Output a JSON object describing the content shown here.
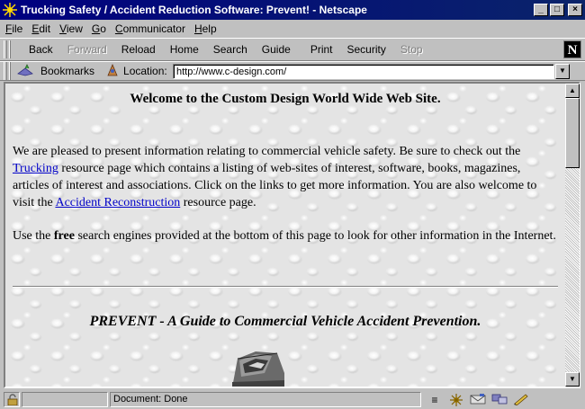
{
  "window": {
    "title": "Trucking Safety / Accident Reduction Software: Prevent! - Netscape",
    "buttons": {
      "minimize": "_",
      "maximize": "□",
      "close": "×"
    }
  },
  "menu": [
    "File",
    "Edit",
    "View",
    "Go",
    "Communicator",
    "Help"
  ],
  "menu_accel": [
    "F",
    "E",
    "V",
    "G",
    "C",
    "H"
  ],
  "toolbar": {
    "back": "Back",
    "forward": "Forward",
    "reload": "Reload",
    "home": "Home",
    "search": "Search",
    "guide": "Guide",
    "print": "Print",
    "security": "Security",
    "stop": "Stop",
    "logo": "N"
  },
  "location_bar": {
    "bookmarks_label": "Bookmarks",
    "location_label": "Location:",
    "url": "http://www.c-design.com/"
  },
  "page": {
    "welcome": "Welcome to the Custom Design World Wide Web Site.",
    "para1_before": "We are pleased to present information relating to commercial vehicle safety. Be sure to check out the ",
    "link_trucking": "Trucking",
    "para1_middle": " resource page which contains a listing of web-sites of interest, software, books, magazines, articles of interest and associations. Click on the links to get more information. You are also welcome to visit the ",
    "link_accident": "Accident Reconstruction",
    "para1_after": " resource page.",
    "para2_before": "Use the ",
    "para2_bold": "free",
    "para2_after": " search engines provided at the bottom of this page to look for other information in the Internet.",
    "prevent_title": "PREVENT - A Guide to Commercial Vehicle Accident Prevention."
  },
  "status": {
    "text": "Document: Done"
  },
  "colors": {
    "titlebar": "#000080",
    "link": "#0000c8",
    "chrome": "#c0c0c0"
  }
}
